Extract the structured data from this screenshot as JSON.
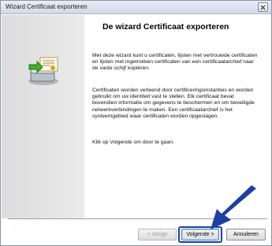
{
  "window": {
    "title": "Wizard Certificaat exporteren"
  },
  "main": {
    "heading": "De wizard Certificaat exporteren",
    "paragraph1": "Met deze wizard kunt u certificaten, lijsten met vertrouwde certificaten en lijsten met ingetrokken certificaten van een certificaatarchief naar de vaste schijf kopiëren.",
    "paragraph2": "Certificaten worden verleend door certificeringsinstanties en worden gebruikt om uw identiteit vast te stellen. Elk certificaat bevat bovendien informatie om gegevens te beschermen en om beveiligde netwerkverbindingen te maken. Een certificaatarchief is het systeemgebied waar certificaten worden opgeslagen.",
    "paragraph3": "Klik op Volgende om door te gaan."
  },
  "buttons": {
    "back": "< Vorige",
    "next": "Volgende >",
    "cancel": "Annuleren"
  },
  "icons": {
    "close": "close-icon",
    "wizard": "certificate-export-icon",
    "annotation": "arrow-icon"
  },
  "colors": {
    "arrow": "#1f3fa0",
    "panel": "#e0e0e0"
  }
}
